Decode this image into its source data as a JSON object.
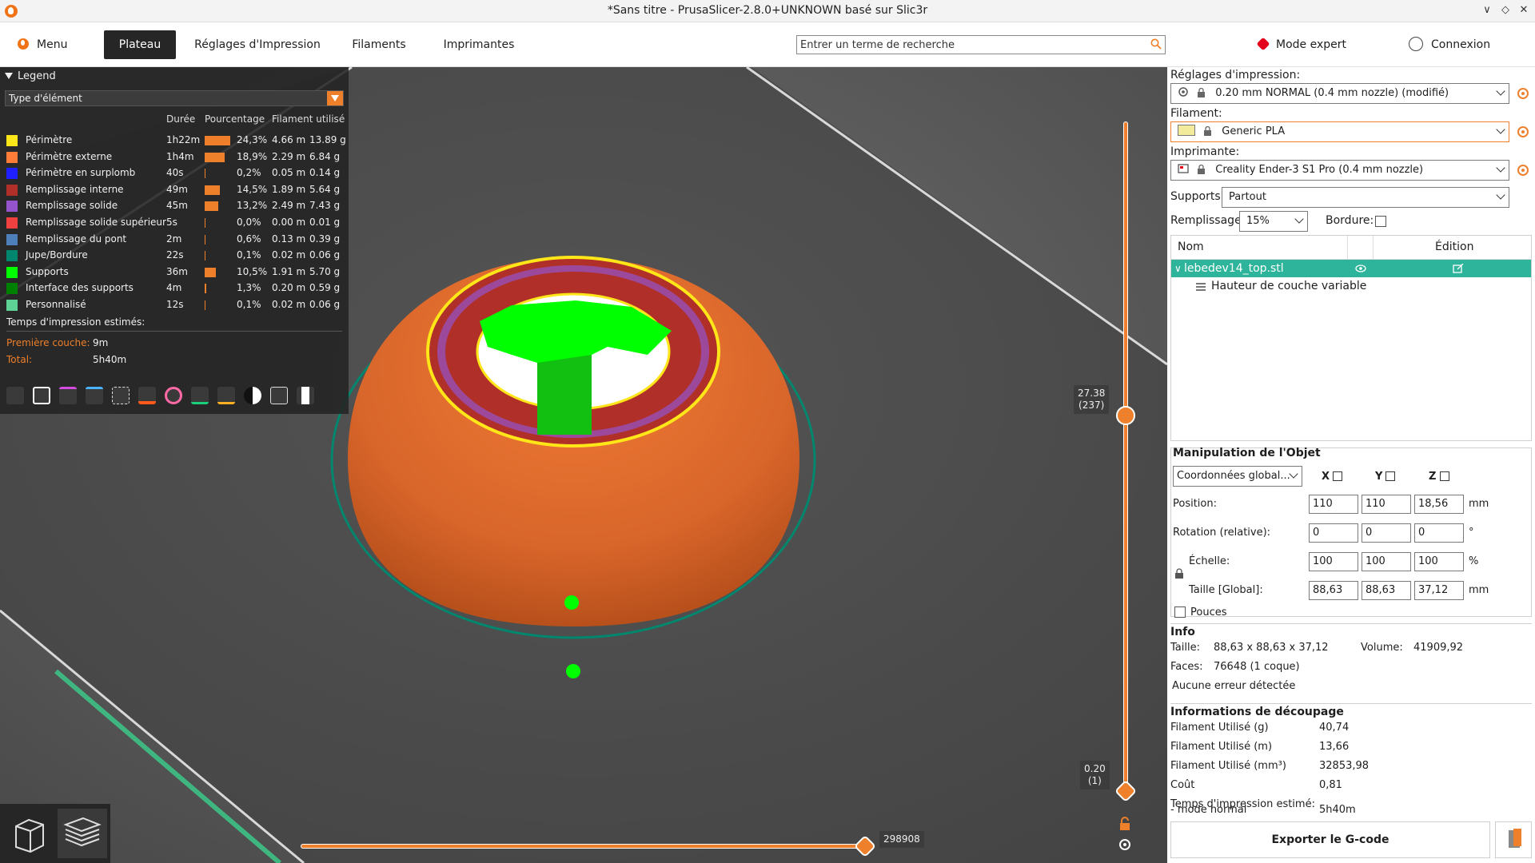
{
  "window": {
    "title": "*Sans titre - PrusaSlicer-2.8.0+UNKNOWN basé sur Slic3r",
    "controls": [
      "∨",
      "◇",
      "✕"
    ]
  },
  "nav": {
    "menu_label": "Menu",
    "tabs": [
      {
        "label": "Plateau",
        "active": true
      },
      {
        "label": "Réglages d'Impression",
        "active": false
      },
      {
        "label": "Filaments",
        "active": false
      },
      {
        "label": "Imprimantes",
        "active": false
      }
    ],
    "search_placeholder": "Entrer un terme de recherche",
    "mode_label": "Mode expert",
    "login_label": "Connexion"
  },
  "legend": {
    "title": "Legend",
    "select_value": "Type d'élément",
    "columns": {
      "duration": "Durée",
      "percent": "Pourcentage",
      "filament": "Filament utilisé"
    },
    "rows": [
      {
        "name": "Périmètre",
        "color": "#ffe619",
        "duration": "1h22m",
        "percent": "24,3%",
        "fraction": 0.243,
        "length": "4.66 m",
        "weight": "13.89 g"
      },
      {
        "name": "Périmètre externe",
        "color": "#ff7d38",
        "duration": "1h4m",
        "percent": "18,9%",
        "fraction": 0.189,
        "length": "2.29 m",
        "weight": "6.84 g"
      },
      {
        "name": "Périmètre en surplomb",
        "color": "#1f1fff",
        "duration": "40s",
        "percent": "0,2%",
        "fraction": 0.002,
        "length": "0.05 m",
        "weight": "0.14 g"
      },
      {
        "name": "Remplissage interne",
        "color": "#b03029",
        "duration": "49m",
        "percent": "14,5%",
        "fraction": 0.145,
        "length": "1.89 m",
        "weight": "5.64 g"
      },
      {
        "name": "Remplissage solide",
        "color": "#9654cc",
        "duration": "45m",
        "percent": "13,2%",
        "fraction": 0.132,
        "length": "2.49 m",
        "weight": "7.43 g"
      },
      {
        "name": "Remplissage solide supérieur",
        "color": "#f04040",
        "duration": "5s",
        "percent": "0,0%",
        "fraction": 0.0,
        "length": "0.00 m",
        "weight": "0.01 g"
      },
      {
        "name": "Remplissage du pont",
        "color": "#4d80ba",
        "duration": "2m",
        "percent": "0,6%",
        "fraction": 0.006,
        "length": "0.13 m",
        "weight": "0.39 g"
      },
      {
        "name": "Jupe/Bordure",
        "color": "#00876e",
        "duration": "22s",
        "percent": "0,1%",
        "fraction": 0.001,
        "length": "0.02 m",
        "weight": "0.06 g"
      },
      {
        "name": "Supports",
        "color": "#00ff00",
        "duration": "36m",
        "percent": "10,5%",
        "fraction": 0.105,
        "length": "1.91 m",
        "weight": "5.70 g"
      },
      {
        "name": "Interface des supports",
        "color": "#008000",
        "duration": "4m",
        "percent": "1,3%",
        "fraction": 0.013,
        "length": "0.20 m",
        "weight": "0.59 g"
      },
      {
        "name": "Personnalisé",
        "color": "#5ed194",
        "duration": "12s",
        "percent": "0,1%",
        "fraction": 0.001,
        "length": "0.02 m",
        "weight": "0.06 g"
      }
    ],
    "estimated_label": "Temps d'impression estimés:",
    "first_layer_label": "Première couche:",
    "first_layer_value": "9m",
    "total_label": "Total:",
    "total_value": "5h40m"
  },
  "slider": {
    "top_value": "27.38",
    "top_layer": "(237)",
    "bottom_value": "0.20",
    "bottom_layer": "(1)",
    "horizontal_value": "298908"
  },
  "panel": {
    "print_settings_label": "Réglages d'impression:",
    "print_settings_value": "0.20 mm NORMAL (0.4 mm nozzle) (modifié)",
    "filament_label": "Filament:",
    "filament_value": "Generic PLA",
    "filament_color": "#f2eb9c",
    "printer_label": "Imprimante:",
    "printer_value": "Creality Ender-3 S1 Pro (0.4 mm nozzle)",
    "supports_label": "Supports:",
    "supports_value": "Partout",
    "infill_label": "Remplissage:",
    "infill_value": "15%",
    "brim_label": "Bordure:"
  },
  "object_list": {
    "col_name": "Nom",
    "col_edit": "Édition",
    "object_name": "lebedev14_top.stl",
    "sub_item": "Hauteur de couche variable"
  },
  "manipulation": {
    "title": "Manipulation de l'Objet",
    "coord_select": "Coordonnées global...",
    "axes": [
      "X",
      "Y",
      "Z"
    ],
    "position_label": "Position:",
    "position": [
      "110",
      "110",
      "18,56"
    ],
    "position_unit": "mm",
    "rotation_label": "Rotation (relative):",
    "rotation": [
      "0",
      "0",
      "0"
    ],
    "rotation_unit": "°",
    "scale_label": "Échelle:",
    "scale": [
      "100",
      "100",
      "100"
    ],
    "scale_unit": "%",
    "size_label": "Taille [Global]:",
    "size": [
      "88,63",
      "88,63",
      "37,12"
    ],
    "size_unit": "mm",
    "inches_label": "Pouces"
  },
  "info": {
    "title": "Info",
    "size_label": "Taille:",
    "size_value": "88,63 x 88,63 x 37,12",
    "volume_label": "Volume:",
    "volume_value": "41909,92",
    "faces_label": "Faces:",
    "faces_value": "76648 (1 coque)",
    "errors": "Aucune erreur détectée"
  },
  "slicing": {
    "title": "Informations de découpage",
    "rows": [
      {
        "label": "Filament Utilisé (g)",
        "value": "40,74"
      },
      {
        "label": "Filament Utilisé (m)",
        "value": "13,66"
      },
      {
        "label": "Filament Utilisé (mm³)",
        "value": "32853,98"
      },
      {
        "label": "Coût",
        "value": "0,81"
      }
    ],
    "time_label": "Temps d'impression estimé:",
    "mode_label": "- mode normal",
    "mode_value": "5h40m"
  },
  "export_label": "Exporter le G-code",
  "colors": {
    "accent": "#ee7f2b",
    "selection": "#2eb49a",
    "dark": "#262626",
    "expert": "#e2001a"
  }
}
